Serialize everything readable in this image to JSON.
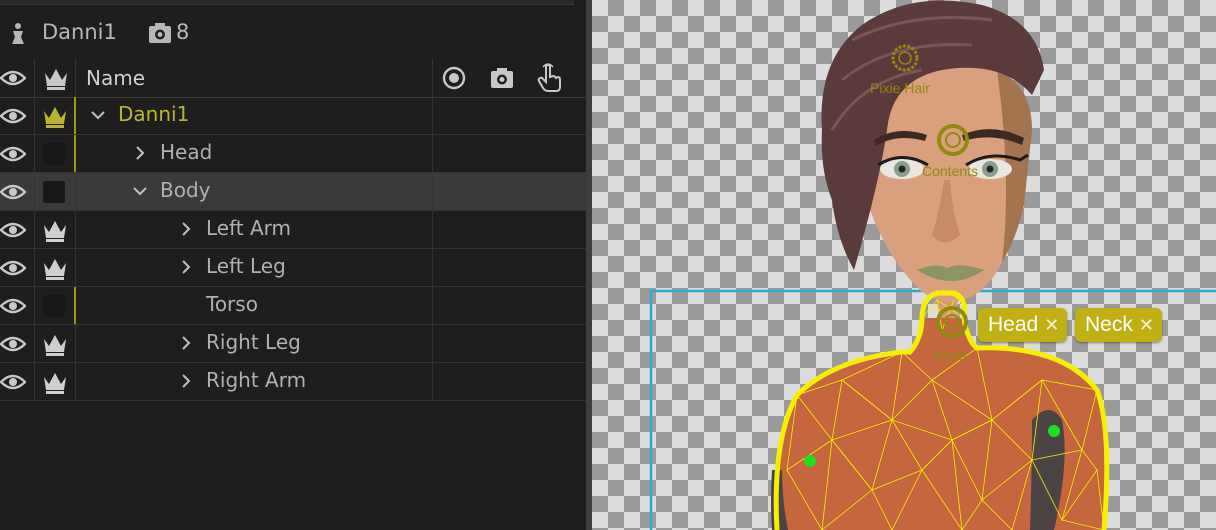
{
  "puppet": {
    "name": "Danni1",
    "rig_count": "8"
  },
  "columns": {
    "name": "Name"
  },
  "rows": [
    {
      "label": "Danni1",
      "indent": 0,
      "chevron": "down",
      "crown": "active",
      "tagged": true,
      "selected": false
    },
    {
      "label": "Head",
      "indent": 1,
      "chevron": "right",
      "crown": "none",
      "tagged": true,
      "selected": false
    },
    {
      "label": "Body",
      "indent": 1,
      "chevron": "down",
      "crown": "none",
      "tagged": false,
      "selected": true
    },
    {
      "label": "Left Arm",
      "indent": 2,
      "chevron": "right",
      "crown": "white",
      "tagged": false,
      "selected": false
    },
    {
      "label": "Left Leg",
      "indent": 2,
      "chevron": "right",
      "crown": "white",
      "tagged": false,
      "selected": false
    },
    {
      "label": "Torso",
      "indent": 2,
      "chevron": "none",
      "crown": "none",
      "tagged": true,
      "selected": false
    },
    {
      "label": "Right Leg",
      "indent": 2,
      "chevron": "right",
      "crown": "white",
      "tagged": false,
      "selected": false
    },
    {
      "label": "Right Arm",
      "indent": 2,
      "chevron": "right",
      "crown": "white",
      "tagged": false,
      "selected": false
    }
  ],
  "canvas": {
    "handle_labels": {
      "pixie_hair": "Pixie Hair",
      "contents": "Contents",
      "head": "Head"
    },
    "tags": {
      "head": "Head",
      "neck": "Neck"
    },
    "remove_glyph": "✕"
  },
  "icons": {
    "puppet": "puppet-icon",
    "rig": "rig-icon",
    "eye": "eye-icon",
    "crown": "crown-icon",
    "origin": "origin-icon",
    "tag": "tag-icon",
    "touch": "hand-touch-icon",
    "chevron_down": "chevron-down-icon",
    "chevron_right": "chevron-right-icon"
  },
  "colors": {
    "accent": "#b9b530",
    "tag_bg": "#c1b013",
    "mesh": "#f6f000",
    "bounds": "#2aa8d8",
    "skin": "#c5663e"
  }
}
